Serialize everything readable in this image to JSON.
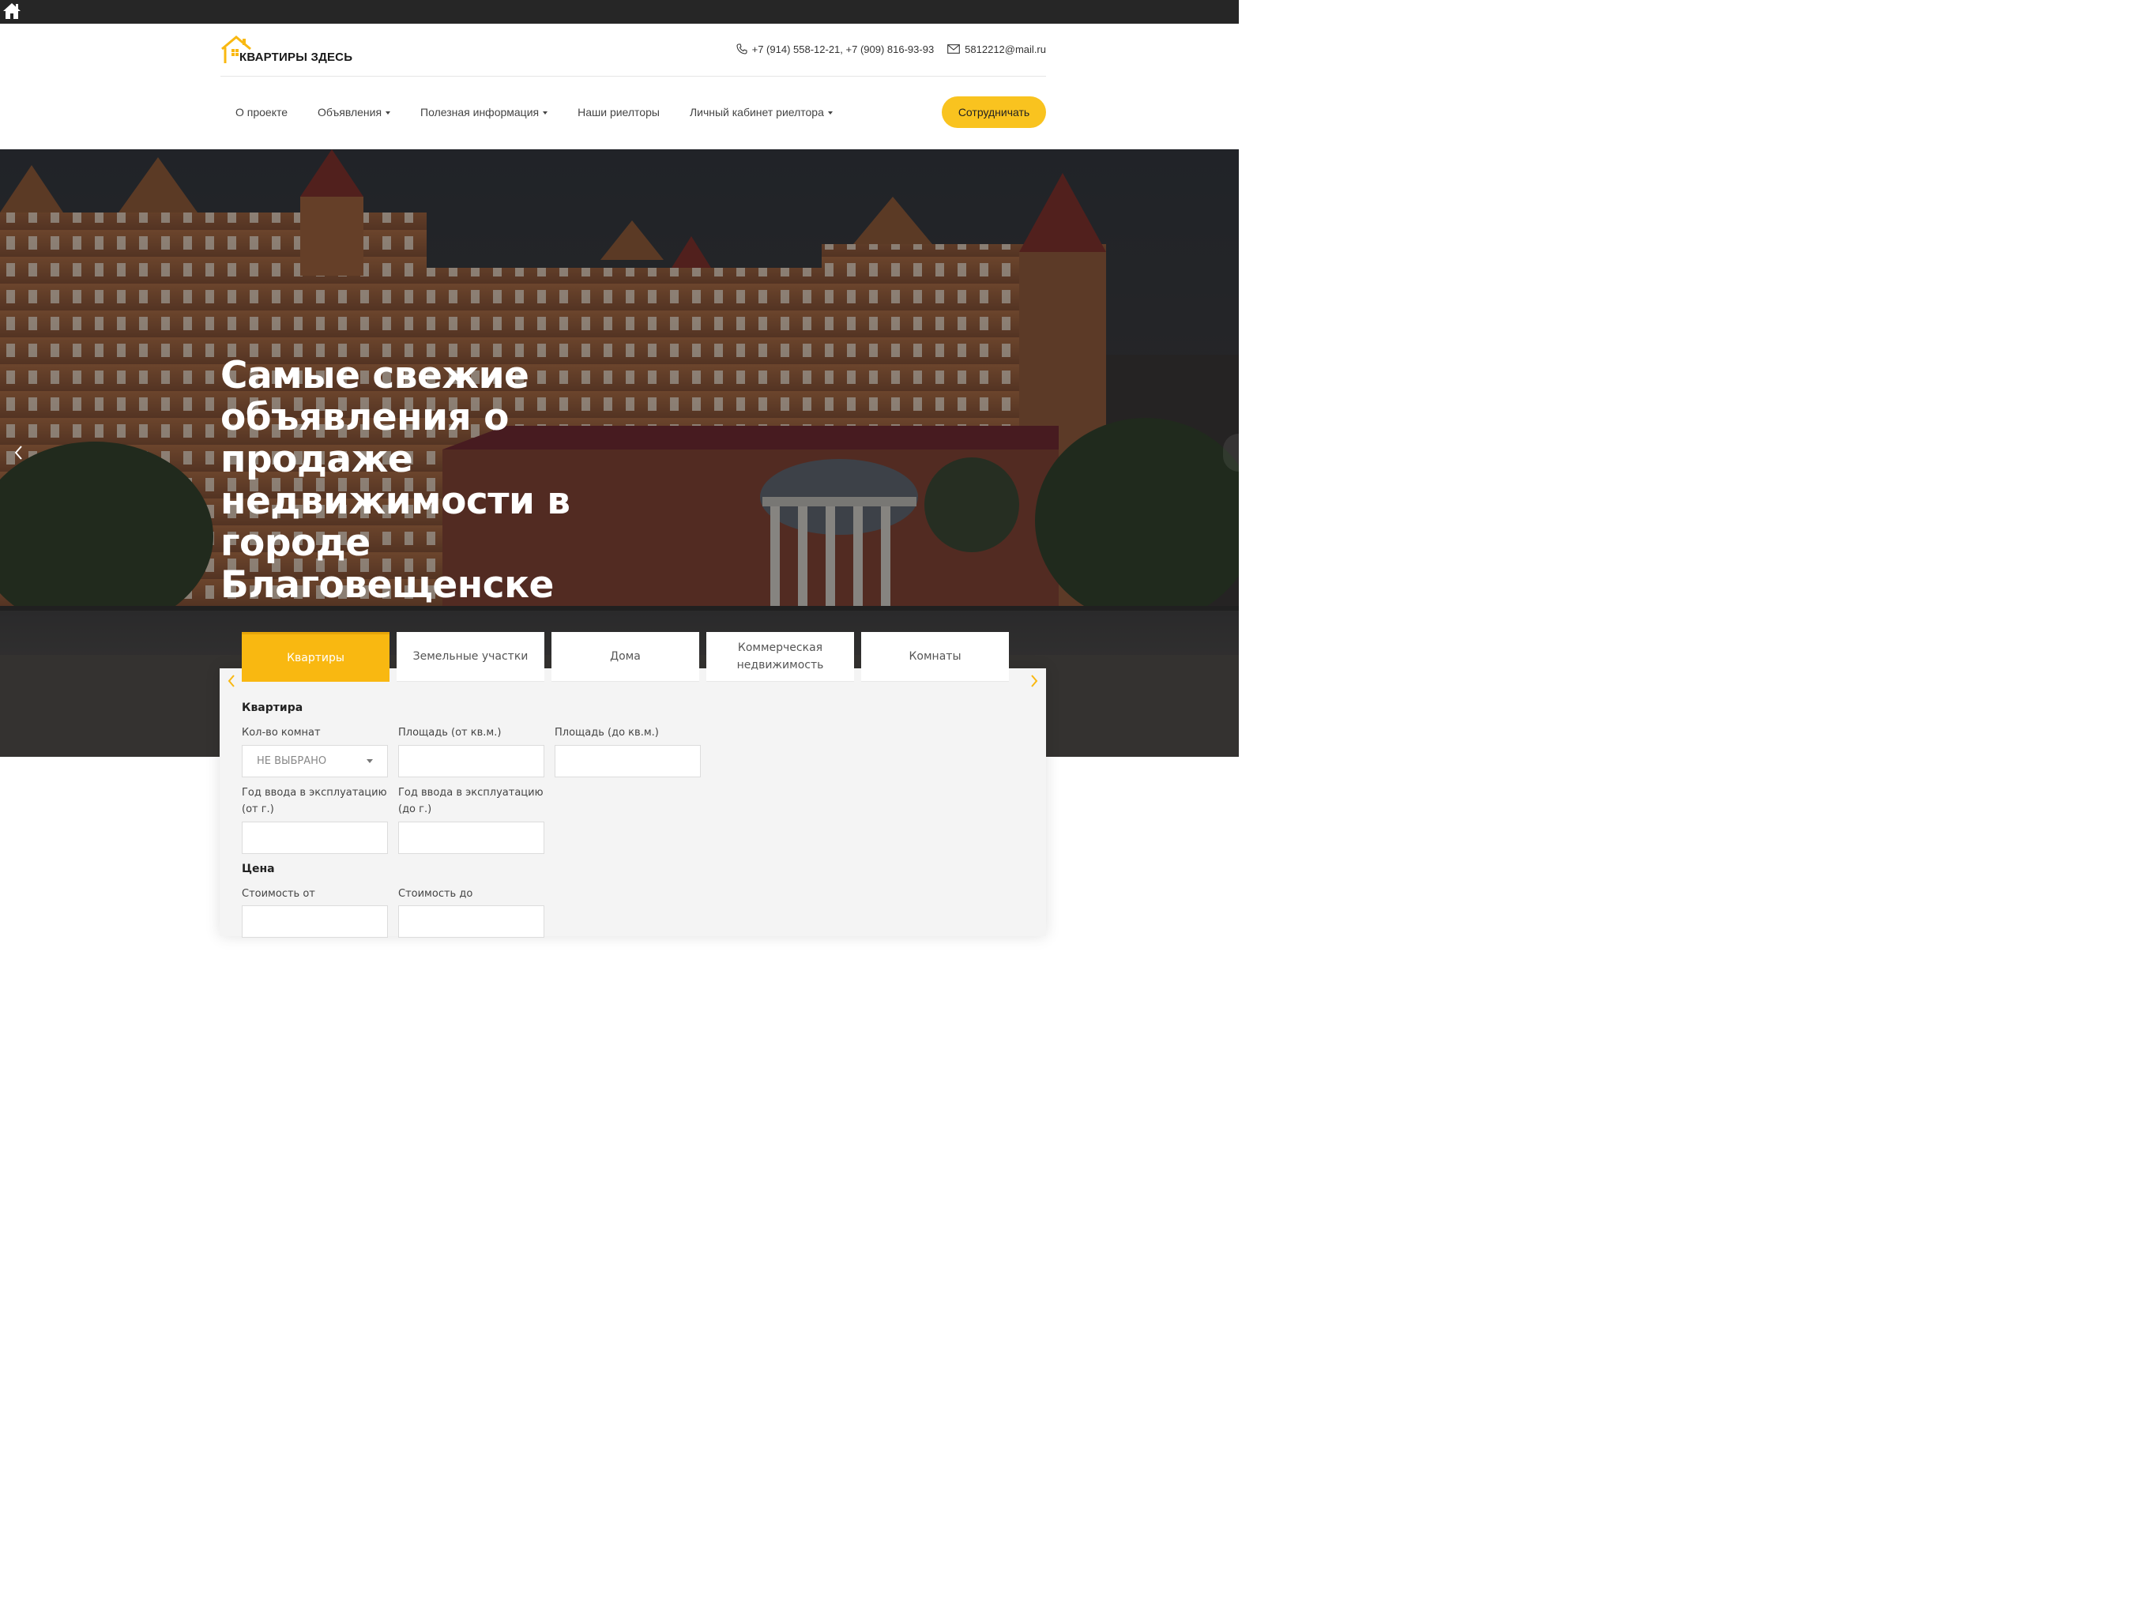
{
  "topbar": {
    "home_icon": "home-icon"
  },
  "header": {
    "logo_text": "КВАРТИРЫ ЗДЕСЬ",
    "phone": "+7 (914) 558-12-21, +7 (909) 816-93-93",
    "email": "5812212@mail.ru",
    "phone_icon": "phone-icon",
    "email_icon": "envelope-icon"
  },
  "nav": {
    "items": [
      {
        "label": "О проекте",
        "dropdown": false
      },
      {
        "label": "Объявления",
        "dropdown": true
      },
      {
        "label": "Полезная информация",
        "dropdown": true
      },
      {
        "label": "Наши риелторы",
        "dropdown": false
      },
      {
        "label": "Личный кабинет риелтора",
        "dropdown": true
      }
    ],
    "cta_label": "Сотрудничать"
  },
  "hero": {
    "title": "Самые свежие объявления о продаже недвижимости в городе Благовещенске"
  },
  "search": {
    "tabs": [
      {
        "label": "Квартиры",
        "active": true
      },
      {
        "label": "Земельные участки",
        "active": false
      },
      {
        "label": "Дома",
        "active": false
      },
      {
        "label": "Коммерческая недвижимость",
        "active": false
      },
      {
        "label": "Комнаты",
        "active": false
      }
    ],
    "section_flat": "Квартира",
    "rooms_label": "Кол-во комнат",
    "rooms_value": "НЕ ВЫБРАНО",
    "area_from_label": "Площадь (от кв.м.)",
    "area_to_label": "Площадь (до кв.м.)",
    "year_from_label": "Год ввода в эксплуатацию (от г.)",
    "year_to_label": "Год ввода в эксплуатацию (до г.)",
    "section_price": "Цена",
    "price_from_label": "Стоимость от",
    "price_to_label": "Стоимость до"
  },
  "colors": {
    "accent": "#f9c31f",
    "active_tab": "#f9b811",
    "topbar": "#262626"
  }
}
